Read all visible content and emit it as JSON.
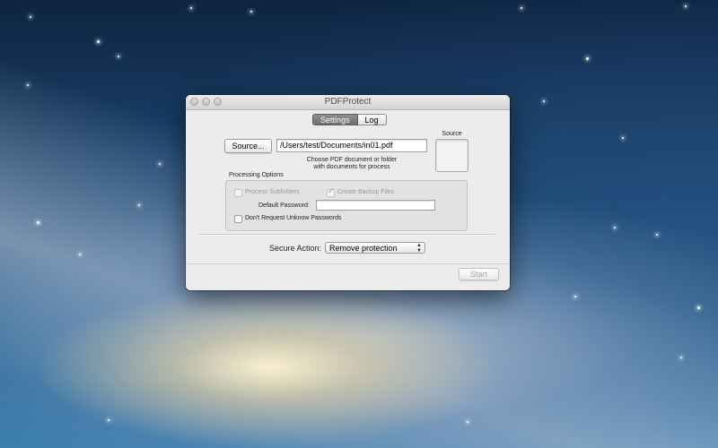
{
  "window": {
    "title": "PDFProtect"
  },
  "tabs": [
    {
      "label": "Settings",
      "active": true
    },
    {
      "label": "Log",
      "active": false
    }
  ],
  "source": {
    "button_label": "Source...",
    "path_value": "/Users/test/Documents/in01.pdf",
    "hint_line1": "Choose PDF document or folder",
    "hint_line2": "with documents for process",
    "well_label": "Source"
  },
  "processing": {
    "group_label": "Processing Options",
    "process_subfolders": {
      "label": "Process Subfolders",
      "checked": false,
      "enabled": false
    },
    "create_backup": {
      "label": "Create Backup Files",
      "checked": true,
      "enabled": false
    },
    "password_label": "Default Password:",
    "password_value": "",
    "dont_request": {
      "label": "Don't Request Unknow Passwords",
      "checked": false,
      "enabled": true
    }
  },
  "action": {
    "label": "Secure Action:",
    "selected": "Remove protection"
  },
  "footer": {
    "start_label": "Start",
    "start_enabled": false
  }
}
